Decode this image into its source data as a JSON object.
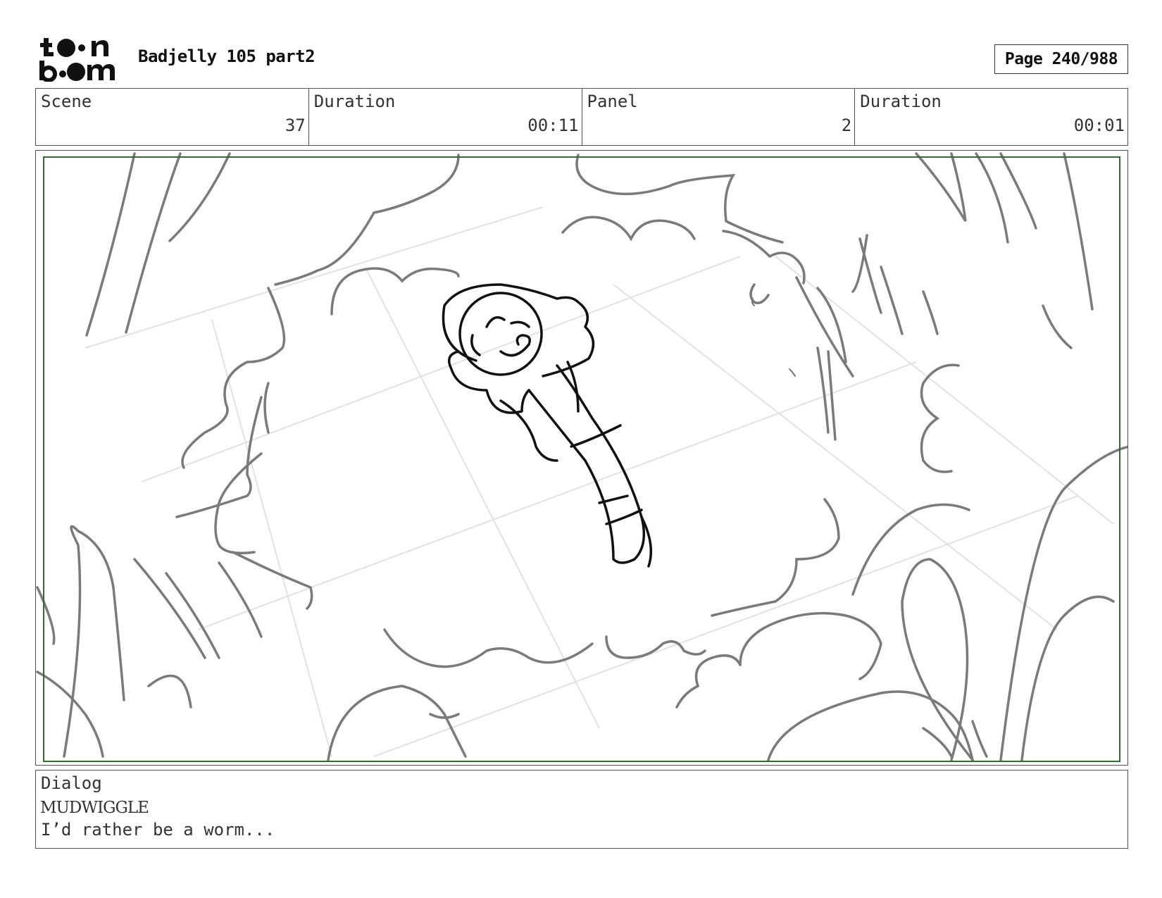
{
  "header": {
    "logo_alt": "toon boom",
    "title": "Badjelly 105 part2",
    "page_label": "Page 240/988"
  },
  "info": {
    "scene_label": "Scene",
    "scene_value": "37",
    "scene_duration_label": "Duration",
    "scene_duration_value": "00:11",
    "panel_label": "Panel",
    "panel_value": "2",
    "panel_duration_label": "Duration",
    "panel_duration_value": "00:01"
  },
  "panel": {
    "safe_frame_color": "#2f6e2f",
    "sketch_color": "#7a7a7a",
    "ink_color": "#111111"
  },
  "dialog": {
    "label": "Dialog",
    "speaker": "MUDWIGGLE",
    "line": "I’d rather be a worm..."
  }
}
